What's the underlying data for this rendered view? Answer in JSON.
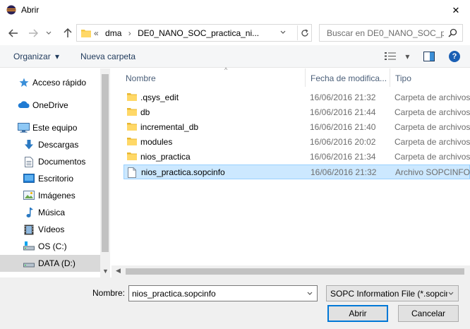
{
  "window": {
    "title": "Abrir",
    "close_glyph": "✕"
  },
  "nav": {
    "back_icon": "arrow-left-icon",
    "forward_icon": "arrow-right-icon",
    "recent_icon": "chevron-down-icon",
    "up_icon": "arrow-up-icon",
    "breadcrumb_overflow": "«",
    "breadcrumbs": [
      "dma",
      "DE0_NANO_SOC_practica_ni..."
    ],
    "breadcrumb_separator": "›",
    "search_placeholder": "Buscar en DE0_NANO_SOC_pr..."
  },
  "toolbar": {
    "organize_label": "Organizar",
    "organize_arrow": "▾",
    "new_folder_label": "Nueva carpeta",
    "view_arrow": "▾",
    "help_label": "?"
  },
  "sidebar": {
    "items": [
      {
        "label": "Acceso rápido",
        "icon": "star-icon"
      },
      {
        "label": "OneDrive",
        "icon": "cloud-icon"
      },
      {
        "label": "Este equipo",
        "icon": "computer-icon"
      },
      {
        "label": "Descargas",
        "icon": "download-icon"
      },
      {
        "label": "Documentos",
        "icon": "document-icon"
      },
      {
        "label": "Escritorio",
        "icon": "desktop-icon"
      },
      {
        "label": "Imágenes",
        "icon": "image-icon"
      },
      {
        "label": "Música",
        "icon": "music-icon"
      },
      {
        "label": "Vídeos",
        "icon": "video-icon"
      },
      {
        "label": "OS (C:)",
        "icon": "drive-icon"
      },
      {
        "label": "DATA (D:)",
        "icon": "drive-icon",
        "selected": true
      }
    ]
  },
  "files": {
    "columns": {
      "name": "Nombre",
      "date": "Fecha de modifica...",
      "type": "Tipo"
    },
    "rows": [
      {
        "name": ".qsys_edit",
        "date": "16/06/2016 21:32",
        "type": "Carpeta de archivos",
        "icon": "folder-icon"
      },
      {
        "name": "db",
        "date": "16/06/2016 21:44",
        "type": "Carpeta de archivos",
        "icon": "folder-icon"
      },
      {
        "name": "incremental_db",
        "date": "16/06/2016 21:40",
        "type": "Carpeta de archivos",
        "icon": "folder-icon"
      },
      {
        "name": "modules",
        "date": "16/06/2016 20:02",
        "type": "Carpeta de archivos",
        "icon": "folder-icon"
      },
      {
        "name": "nios_practica",
        "date": "16/06/2016 21:34",
        "type": "Carpeta de archivos",
        "icon": "folder-icon"
      },
      {
        "name": "nios_practica.sopcinfo",
        "date": "16/06/2016 21:32",
        "type": "Archivo SOPCINFO",
        "icon": "file-icon",
        "selected": true
      }
    ]
  },
  "footer": {
    "name_label": "Nombre:",
    "name_value": "nios_practica.sopcinfo",
    "filter_value": "SOPC Information File (*.sopcin",
    "open_label": "Abrir",
    "cancel_label": "Cancelar"
  },
  "colors": {
    "accent": "#0078d7",
    "selection_bg": "#cce8ff",
    "folder": "#f5c842"
  }
}
